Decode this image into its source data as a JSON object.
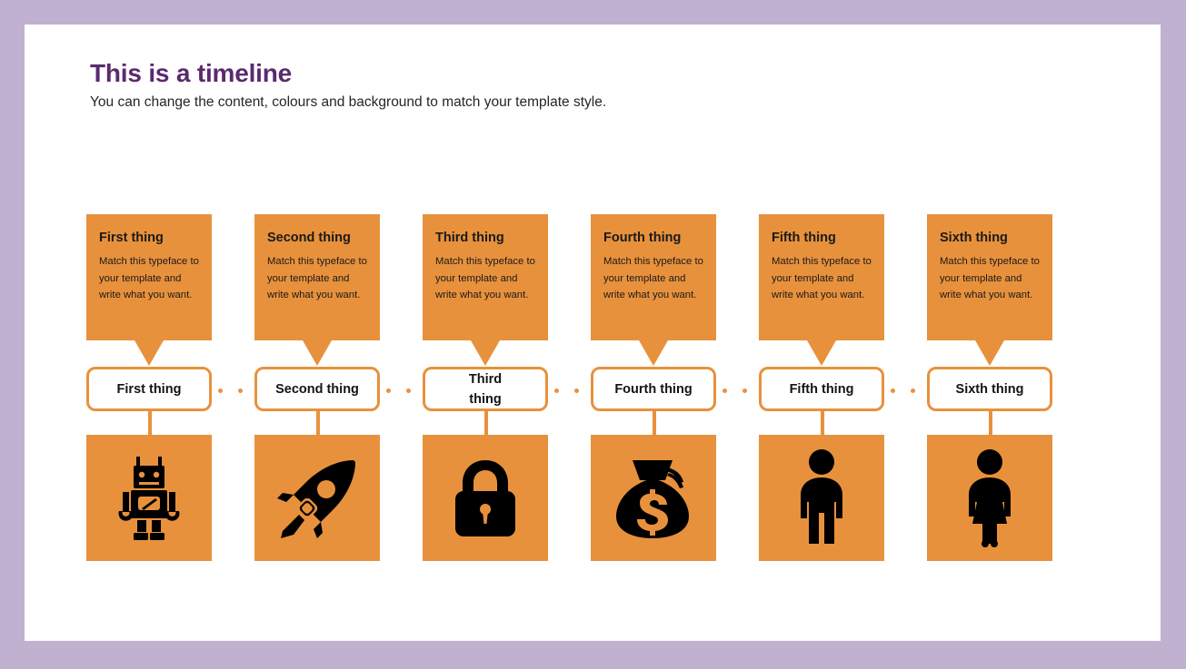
{
  "slide": {
    "title": "This is a timeline",
    "subtitle": "You can change the content, colours and background to match your template style.",
    "title_color": "#5b2a6e",
    "accent_color": "#e8913c",
    "canvas_background": "#ffffff",
    "frame_background": "#c0b1d1",
    "icon_color": "#000000"
  },
  "timeline": {
    "steps": [
      {
        "card_title": "First thing",
        "card_body": "Match this typeface to your template and write what you want.",
        "pill_label": "First thing",
        "icon": "robot-icon"
      },
      {
        "card_title": "Second thing",
        "card_body": "Match this typeface to your template and write what you want.",
        "pill_label": "Second thing",
        "icon": "rocket-icon"
      },
      {
        "card_title": "Third thing",
        "card_body": "Match this typeface to your template and write what you want.",
        "pill_label": "Third thing",
        "icon": "lock-icon"
      },
      {
        "card_title": "Fourth thing",
        "card_body": "Match this typeface to your template and write what you want.",
        "pill_label": "Fourth thing",
        "icon": "money-bag-icon"
      },
      {
        "card_title": "Fifth thing",
        "card_body": "Match this typeface to your template and write what you want.",
        "pill_label": "Fifth thing",
        "icon": "man-icon"
      },
      {
        "card_title": "Sixth thing",
        "card_body": "Match this typeface to your template and write what you want.",
        "pill_label": "Sixth thing",
        "icon": "woman-icon"
      }
    ]
  }
}
